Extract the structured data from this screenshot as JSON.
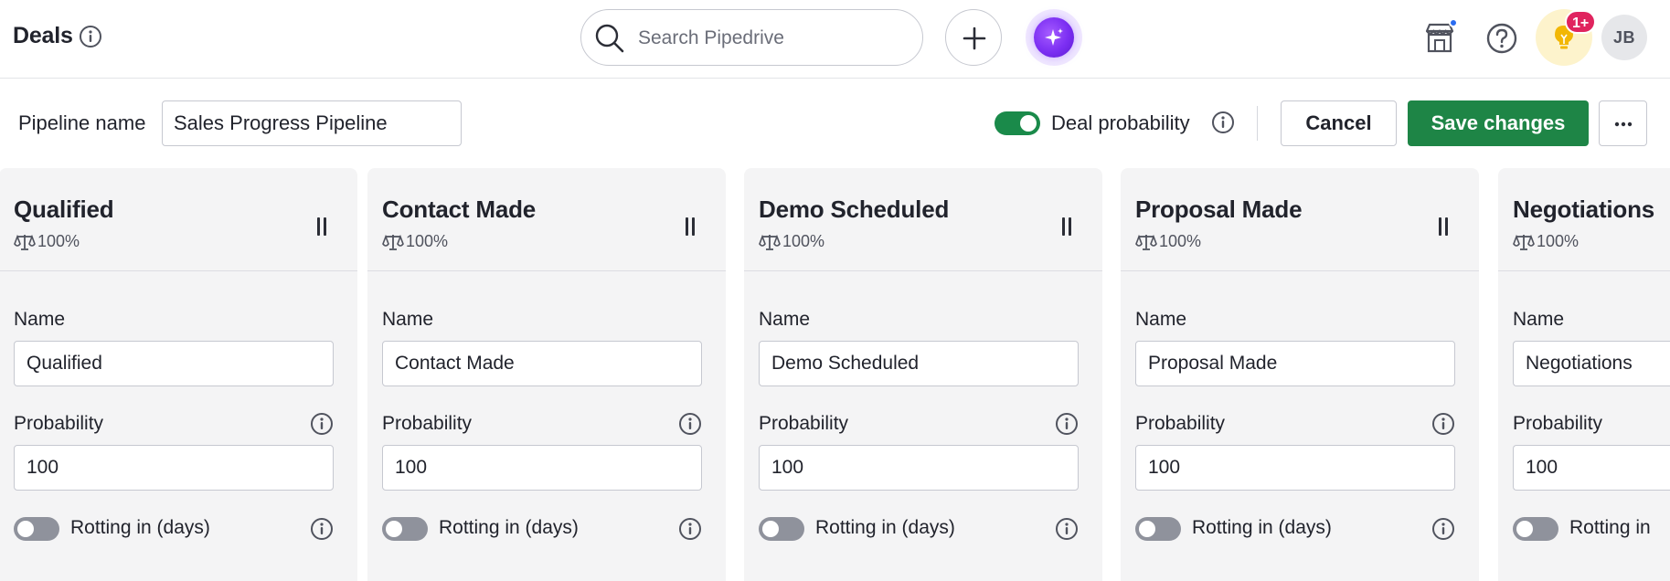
{
  "header": {
    "title": "Deals",
    "search_placeholder": "Search Pipedrive",
    "tips_badge": "1+",
    "avatar_initials": "JB"
  },
  "pipeline": {
    "name_label": "Pipeline name",
    "name_value": "Sales Progress Pipeline",
    "deal_probability_label": "Deal probability",
    "deal_probability_enabled": true,
    "cancel_label": "Cancel",
    "save_label": "Save changes"
  },
  "colors": {
    "accent_green": "#1e8546",
    "toggle_on": "#1a8a4a",
    "badge_red": "#e0245e",
    "ai_purple": "#7b2ef2"
  },
  "stages": [
    {
      "title": "Qualified",
      "probability_display": "100%",
      "name_label": "Name",
      "name_value": "Qualified",
      "probability_label": "Probability",
      "probability_value": "100",
      "rotting_label": "Rotting in (days)",
      "rotting_enabled": false
    },
    {
      "title": "Contact Made",
      "probability_display": "100%",
      "name_label": "Name",
      "name_value": "Contact Made",
      "probability_label": "Probability",
      "probability_value": "100",
      "rotting_label": "Rotting in (days)",
      "rotting_enabled": false
    },
    {
      "title": "Demo Scheduled",
      "probability_display": "100%",
      "name_label": "Name",
      "name_value": "Demo Scheduled",
      "probability_label": "Probability",
      "probability_value": "100",
      "rotting_label": "Rotting in (days)",
      "rotting_enabled": false
    },
    {
      "title": "Proposal Made",
      "probability_display": "100%",
      "name_label": "Name",
      "name_value": "Proposal Made",
      "probability_label": "Probability",
      "probability_value": "100",
      "rotting_label": "Rotting in (days)",
      "rotting_enabled": false
    },
    {
      "title": "Negotiations",
      "probability_display": "100%",
      "name_label": "Name",
      "name_value": "Negotiations",
      "probability_label": "Probability",
      "probability_value": "100",
      "rotting_label": "Rotting in",
      "rotting_enabled": false
    }
  ]
}
